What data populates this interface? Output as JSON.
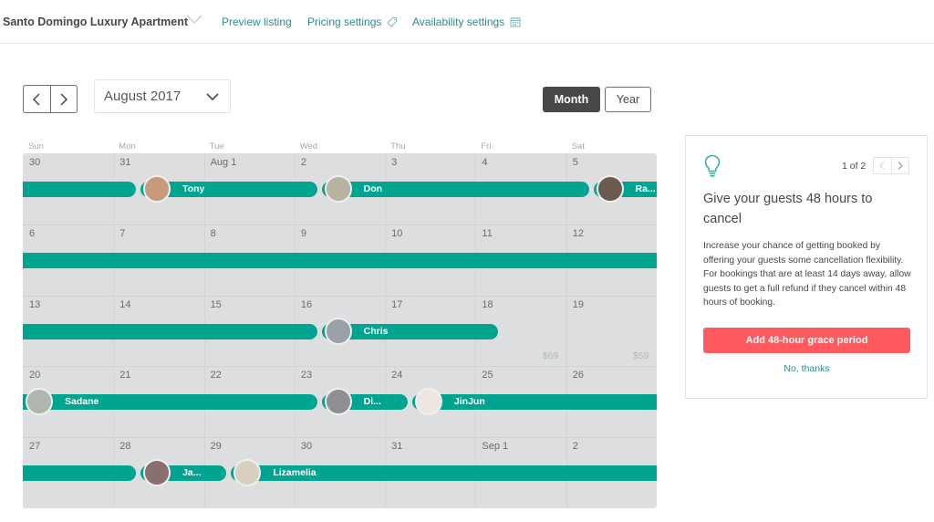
{
  "topnav": {
    "listing_title": "Santo Domingo Luxury Apartment",
    "links": [
      {
        "label": "Preview listing",
        "icon": ""
      },
      {
        "label": "Pricing settings",
        "icon": "tag-icon"
      },
      {
        "label": "Availability settings",
        "icon": "calendar-icon"
      }
    ]
  },
  "controls": {
    "prev_icon": "chevron-left-icon",
    "next_icon": "chevron-right-icon",
    "month_value": "August 2017",
    "view_month": "Month",
    "view_year": "Year",
    "active_view": "Month"
  },
  "calendar": {
    "weekdays": [
      "Sun",
      "Mon",
      "Tue",
      "Wed",
      "Thu",
      "Fri",
      "Sat"
    ],
    "weeks": [
      [
        "30",
        "31",
        "Aug 1",
        "2",
        "3",
        "4",
        "5"
      ],
      [
        "6",
        "7",
        "8",
        "9",
        "10",
        "11",
        "12"
      ],
      [
        "13",
        "14",
        "15",
        "16",
        "17",
        "18",
        "19"
      ],
      [
        "20",
        "21",
        "22",
        "23",
        "24",
        "25",
        "26"
      ],
      [
        "27",
        "28",
        "29",
        "30",
        "31",
        "Sep 1",
        "2"
      ]
    ],
    "prices": [
      {
        "week": 2,
        "day": 5,
        "label": "$69"
      },
      {
        "week": 2,
        "day": 6,
        "label": "$59"
      }
    ],
    "reservations": [
      {
        "guest": "",
        "week": 0,
        "start": 0.0,
        "end": 1.25
      },
      {
        "guest": "Tony",
        "week": 0,
        "start": 1.3,
        "end": 3.25
      },
      {
        "guest": "Don",
        "week": 0,
        "start": 3.3,
        "end": 6.25
      },
      {
        "guest": "Ra...",
        "week": 0,
        "start": 6.3,
        "end": 7.0
      },
      {
        "guest": "",
        "week": 1,
        "start": 0.0,
        "end": 7.0
      },
      {
        "guest": "",
        "week": 2,
        "start": 0.0,
        "end": 3.25
      },
      {
        "guest": "Chris",
        "week": 2,
        "start": 3.3,
        "end": 5.25
      },
      {
        "guest": "Sadane",
        "week": 3,
        "start": 0.0,
        "end": 3.25
      },
      {
        "guest": "Di...",
        "week": 3,
        "start": 3.3,
        "end": 4.25
      },
      {
        "guest": "JinJun",
        "week": 3,
        "start": 4.3,
        "end": 7.0
      },
      {
        "guest": "",
        "week": 4,
        "start": 0.0,
        "end": 1.25
      },
      {
        "guest": "Ja...",
        "week": 4,
        "start": 1.3,
        "end": 2.25
      },
      {
        "guest": "Lizamelia",
        "week": 4,
        "start": 2.3,
        "end": 7.0
      }
    ],
    "colors": {
      "reservation": "#00a591",
      "grid": "#dcdee0"
    }
  },
  "tip_card": {
    "icon": "lightbulb-icon",
    "pager_text": "1 of 2",
    "title": "Give your guests 48 hours to cancel",
    "body": "Increase your chance of getting booked by offering your guests some cancellation flexibility. For bookings that are at least 14 days away, allow guests to get a full refund if they cancel within 48 hours of booking.",
    "cta_label": "Add 48-hour grace period",
    "dismiss_label": "No, thanks",
    "cta_color": "#ff5a5f"
  }
}
